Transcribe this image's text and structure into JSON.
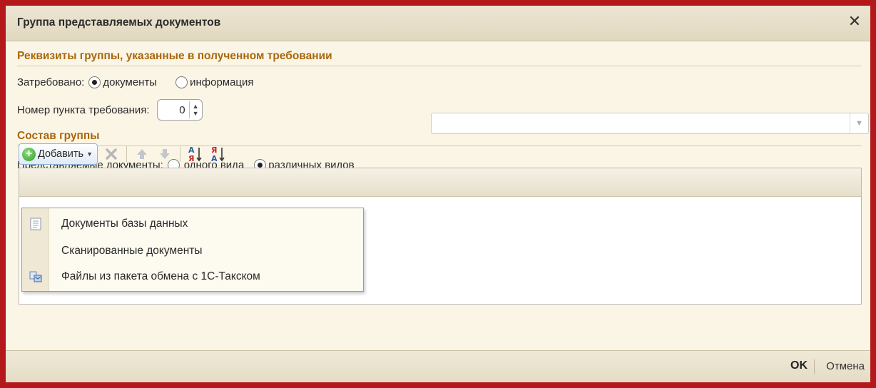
{
  "window": {
    "title": "Группа представляемых документов",
    "close_glyph": "✕"
  },
  "section1": {
    "heading": "Реквизиты группы, указанные в полученном требовании",
    "requested_label": "Затребовано:",
    "requested_options": [
      {
        "label": "документы",
        "selected": true
      },
      {
        "label": "информация",
        "selected": false
      }
    ],
    "item_number_label": "Номер пункта требования:",
    "item_number_value": "0"
  },
  "section2": {
    "heading": "Состав группы",
    "docs_label": "Представляемые документы:",
    "docs_options": [
      {
        "label": "одного вида",
        "selected": false
      },
      {
        "label": "различных видов",
        "selected": true
      }
    ],
    "combo_value": ""
  },
  "toolbar": {
    "add_label": "Добавить",
    "icons": [
      "delete-icon",
      "move-up-icon",
      "move-down-icon",
      "sort-ascending-icon",
      "sort-descending-icon"
    ]
  },
  "dropdown": {
    "items": [
      {
        "label": "Документы базы данных",
        "icon": "document-icon"
      },
      {
        "label": "Сканированные документы",
        "icon": ""
      },
      {
        "label": "Файлы из пакета обмена с 1С-Такском",
        "icon": "exchange-package-icon"
      }
    ]
  },
  "footer": {
    "ok_label": "OK",
    "cancel_label": "Отмена"
  },
  "colors": {
    "frame": "#b5181b",
    "section_heading": "#a8670c",
    "background": "#fbf5e6"
  }
}
